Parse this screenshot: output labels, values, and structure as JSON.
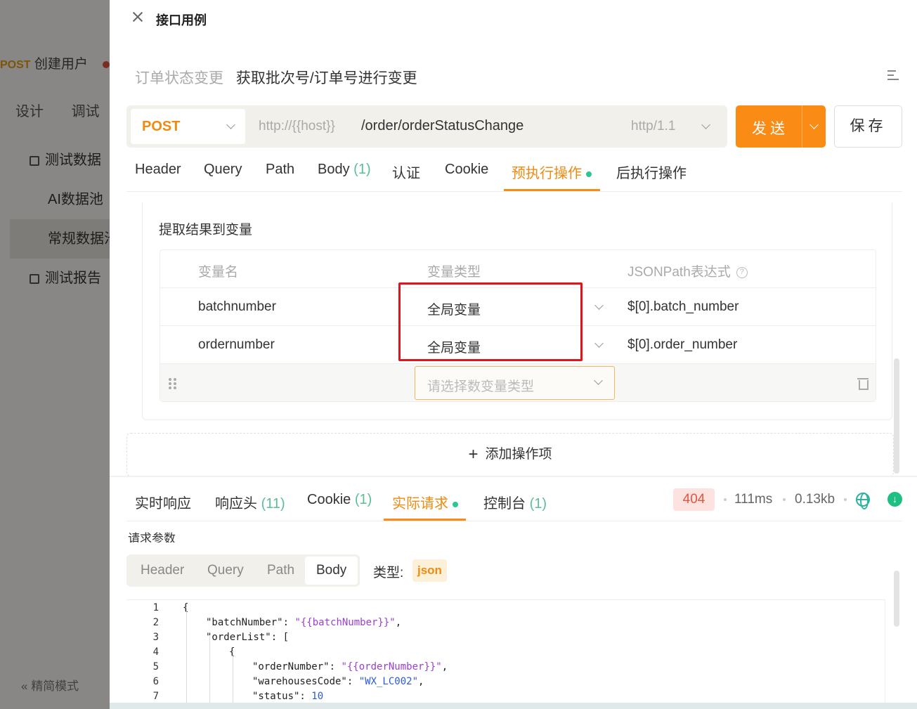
{
  "background": {
    "tab": {
      "method": "POST",
      "name": "创建用户"
    },
    "subtabs": [
      "设计",
      "调试"
    ],
    "menu": [
      {
        "label": "测试数据",
        "level": 1,
        "icon": "chart-icon"
      },
      {
        "label": "AI数据池",
        "level": 2
      },
      {
        "label": "常规数据池",
        "level": 2,
        "selected": true
      },
      {
        "label": "测试报告",
        "level": 1,
        "icon": "report-icon"
      }
    ],
    "footer": "精简模式"
  },
  "drawer": {
    "title": "接口用例",
    "case_group": "订单状态变更",
    "case_name": "获取批次号/订单号进行变更"
  },
  "request": {
    "method": "POST",
    "host": "http://{{host}}",
    "path": "/order/orderStatusChange",
    "protocol": "http/1.1",
    "send_label": "发送",
    "save_label": "保存",
    "tabs": [
      {
        "label": "Header"
      },
      {
        "label": "Query"
      },
      {
        "label": "Path"
      },
      {
        "label": "Body",
        "count": "(1)"
      },
      {
        "label": "认证"
      },
      {
        "label": "Cookie"
      },
      {
        "label": "预执行操作",
        "active": true
      },
      {
        "label": "后执行操作"
      }
    ]
  },
  "extract": {
    "title": "提取结果到变量",
    "headers": {
      "name": "变量名",
      "type": "变量类型",
      "jsonpath": "JSONPath表达式"
    },
    "rows": [
      {
        "name": "batchnumber",
        "type": "全局变量",
        "jsonpath": "$[0].batch_number"
      },
      {
        "name": "ordernumber",
        "type": "全局变量",
        "jsonpath": "$[0].order_number"
      }
    ],
    "new_row_placeholder": "请选择数变量类型",
    "add_operation": "添加操作项"
  },
  "response": {
    "tabs": [
      {
        "label": "实时响应"
      },
      {
        "label": "响应头",
        "count": "(11)"
      },
      {
        "label": "Cookie",
        "count": "(1)"
      },
      {
        "label": "实际请求",
        "active": true
      },
      {
        "label": "控制台",
        "count": "(1)"
      }
    ],
    "status": "404",
    "time": "111ms",
    "size": "0.13kb",
    "params_title": "请求参数",
    "body_tabs": [
      "Header",
      "Query",
      "Path",
      "Body"
    ],
    "type_label": "类型:",
    "type_value": "json"
  },
  "code_lines": [
    {
      "n": "1",
      "indent": 0,
      "parts": [
        [
          "k",
          "{"
        ]
      ]
    },
    {
      "n": "2",
      "indent": 1,
      "parts": [
        [
          "k",
          "\"batchNumber\": "
        ],
        [
          "s",
          "\"{{batchNumber}}\""
        ],
        [
          "k",
          ","
        ]
      ]
    },
    {
      "n": "3",
      "indent": 1,
      "parts": [
        [
          "k",
          "\"orderList\": ["
        ]
      ]
    },
    {
      "n": "4",
      "indent": 2,
      "parts": [
        [
          "k",
          "{"
        ]
      ]
    },
    {
      "n": "5",
      "indent": 3,
      "parts": [
        [
          "k",
          "\"orderNumber\": "
        ],
        [
          "s",
          "\"{{orderNumber}}\""
        ],
        [
          "k",
          ","
        ]
      ]
    },
    {
      "n": "6",
      "indent": 3,
      "parts": [
        [
          "k",
          "\"warehousesCode\": "
        ],
        [
          "n",
          "\"WX_LC002\""
        ],
        [
          "k",
          ","
        ]
      ]
    },
    {
      "n": "7",
      "indent": 3,
      "parts": [
        [
          "k",
          "\"status\": "
        ],
        [
          "n",
          "10"
        ]
      ]
    }
  ],
  "colors": {
    "accent": "#fa8c16",
    "active_dot": "#2bc78e",
    "error": "#e2553f",
    "highlight_box": "#e0141a"
  }
}
